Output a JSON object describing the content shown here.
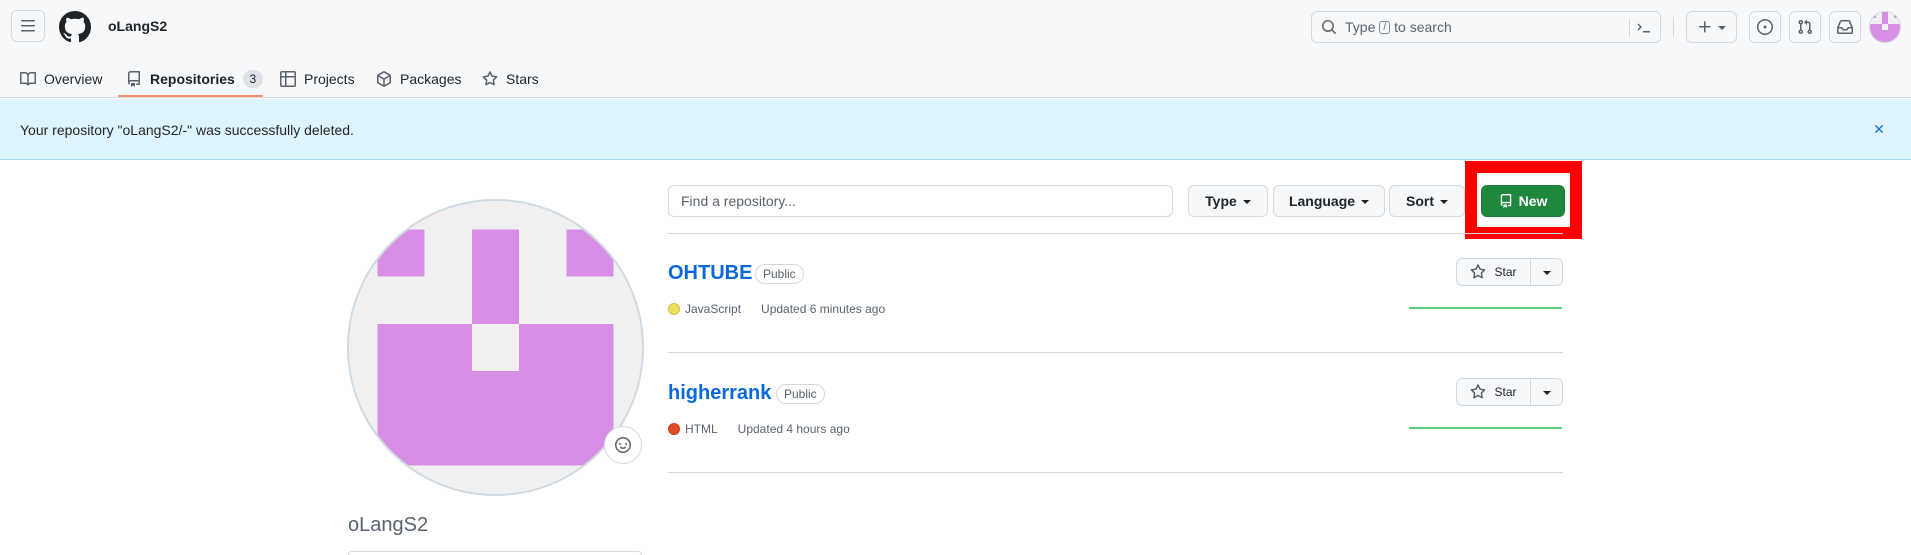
{
  "header": {
    "username": "oLangS2",
    "search_type": "Type",
    "search_key": "/",
    "search_suffix": "to search"
  },
  "tabs": [
    {
      "label": "Overview",
      "icon": "book-icon"
    },
    {
      "label": "Repositories",
      "icon": "repo-icon",
      "count": "3",
      "active": true
    },
    {
      "label": "Projects",
      "icon": "table-icon"
    },
    {
      "label": "Packages",
      "icon": "package-icon"
    },
    {
      "label": "Stars",
      "icon": "star-icon"
    }
  ],
  "flash": {
    "message": "Your repository \"oLangS2/-\" was successfully deleted."
  },
  "profile": {
    "name": "oLangS2",
    "avatar_color": "#d78fe6"
  },
  "toolbar": {
    "search_placeholder": "Find a repository...",
    "type_label": "Type",
    "language_label": "Language",
    "sort_label": "Sort",
    "new_label": "New",
    "new_color": "#1f883d",
    "highlight_color": "#ff0000"
  },
  "repos": [
    {
      "name": "OHTUBE",
      "visibility": "Public",
      "language": "JavaScript",
      "language_color": "#f1e05a",
      "updated": "Updated 6 minutes ago",
      "star_label": "Star"
    },
    {
      "name": "higherrank",
      "visibility": "Public",
      "language": "HTML",
      "language_color": "#e34c26",
      "updated": "Updated 4 hours ago",
      "star_label": "Star"
    }
  ]
}
